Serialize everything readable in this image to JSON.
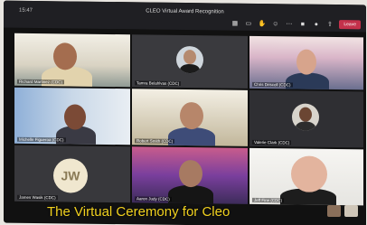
{
  "window": {
    "time": "15:47",
    "meeting_title": "CLEO Virtual Award Recognition",
    "leave_label": "Leave"
  },
  "toolbar_icons": [
    "grid-icon",
    "chat-icon",
    "hand-icon",
    "reactions-icon",
    "more-icon",
    "camera-icon",
    "mic-icon",
    "share-icon"
  ],
  "participants": [
    {
      "name": "Richard Martinez (CDC)",
      "type": "video"
    },
    {
      "name": "Tamra Belahlvas (CDC)",
      "type": "photo"
    },
    {
      "name": "Chris Driscoll (CDC)",
      "type": "video"
    },
    {
      "name": "Michelle Figueroa (CDC)",
      "type": "video"
    },
    {
      "name": "Robert Smith (CDC)",
      "type": "video"
    },
    {
      "name": "Valerie Clark (CDC)",
      "type": "photo"
    },
    {
      "name": "James Wasik (CDC)",
      "type": "initials",
      "initials": "JW"
    },
    {
      "name": "Aaron Judy (CDC)",
      "type": "video"
    },
    {
      "name": "Jeff Fine (CDC)",
      "type": "video"
    }
  ],
  "caption": "The Virtual Ceremony for Cleo"
}
